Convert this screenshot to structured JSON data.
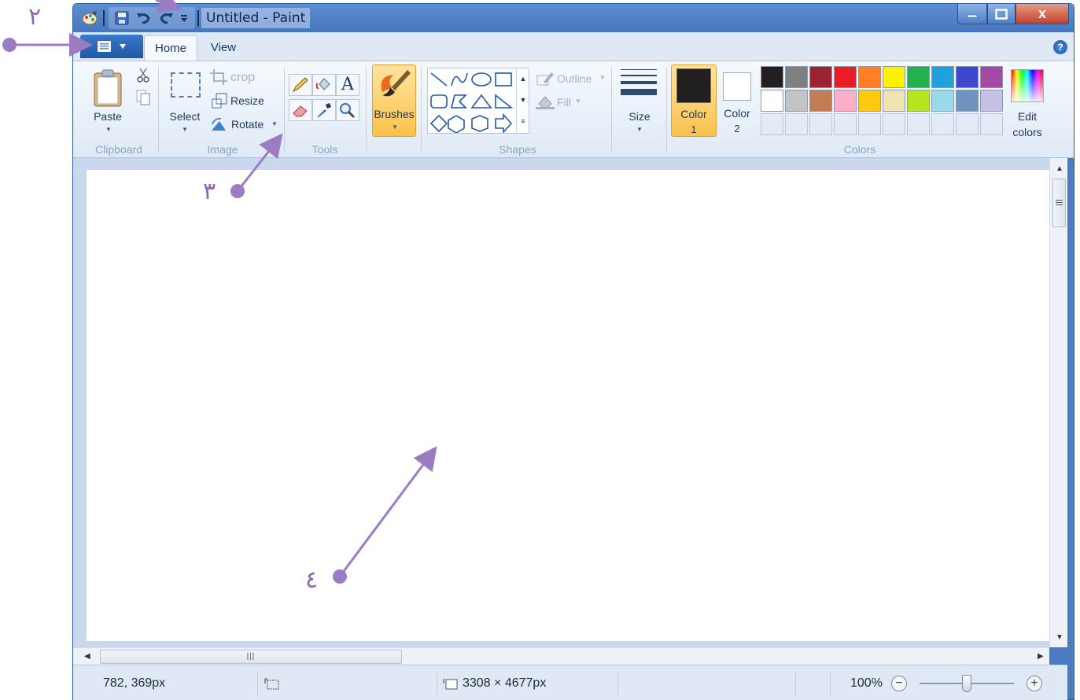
{
  "window": {
    "title": "Untitled - Paint",
    "close_glyph": "x"
  },
  "quick_access": {
    "icons": [
      "paint-icon",
      "save-icon",
      "undo-icon",
      "redo-icon",
      "customize-dropdown-icon"
    ]
  },
  "tabs": [
    {
      "label": "Home"
    },
    {
      "label": "View"
    }
  ],
  "help_glyph": "?",
  "ribbon": {
    "clipboard": {
      "paste_label": "Paste",
      "group_label": "Clipboard"
    },
    "image": {
      "select_label": "Select",
      "crop_label": "crop",
      "resize_label": "Resize",
      "rotate_label": "Rotate",
      "group_label": "Image"
    },
    "tools": {
      "group_label": "Tools",
      "text_glyph": "A"
    },
    "brushes": {
      "label": "Brushes"
    },
    "shapes": {
      "group_label": "Shapes",
      "outline_label": "Outline",
      "fill_label": "Fill"
    },
    "size": {
      "label": "Size"
    },
    "colors": {
      "color1_label": "Color",
      "color1_num": "1",
      "color2_label": "Color",
      "color2_num": "2",
      "color1_value": "#231f20",
      "color2_value": "#ffffff",
      "group_label": "Colors",
      "edit_label_1": "Edit",
      "edit_label_2": "colors",
      "palette_row1": [
        "#231f20",
        "#7f7f7f",
        "#9b2433",
        "#ec1c24",
        "#ff7f27",
        "#fff200",
        "#22b14c",
        "#1ea2dc",
        "#3f48cc",
        "#a349a4"
      ],
      "palette_row2": [
        "#ffffff",
        "#c3c3c3",
        "#c27c52",
        "#ffaec9",
        "#ffc90e",
        "#efe4b0",
        "#b5e61d",
        "#99d9ea",
        "#7092be",
        "#c8bfe7"
      ]
    }
  },
  "status": {
    "cursor_position": "782, 369px",
    "canvas_size": "3308 × 4677px",
    "zoom": "100%",
    "zoom_level": 0.5
  },
  "annotations": {
    "label_2": "٢",
    "label_3": "٣",
    "label_4": "٤"
  }
}
